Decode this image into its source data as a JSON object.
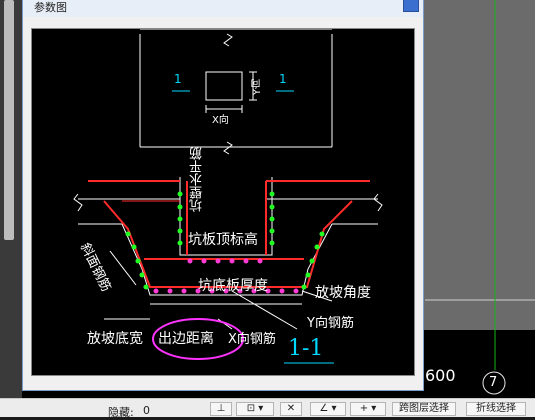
{
  "dialog": {
    "title": "参数图"
  },
  "background": {
    "dimension_text": "600",
    "grid_label": "7"
  },
  "drawing": {
    "top_labels": {
      "section_left": "1",
      "section_right": "1",
      "x_dir": "X向",
      "y_dir": "Y向"
    },
    "labels": {
      "pit_wall_rebar": "坑壁水平筋",
      "pit_top_elev": "坑板顶标高",
      "slope_face_rebar": "斜面钢筋",
      "pit_bottom_thickness": "坑底板厚度",
      "slope_angle": "放坡角度",
      "y_rebar": "Y向钢筋",
      "slope_bottom_width": "放坡底宽",
      "edge_distance": "出边距离",
      "x_rebar": "X向钢筋",
      "section_name": "1-1"
    }
  },
  "statusbar": {
    "hidden_label": "隐藏:",
    "hidden_value": "0",
    "cross_layer_select": "跨图层选择",
    "polyline_select": "折线选择"
  },
  "colors": {
    "rebar": "#ff2a2a",
    "stirrup_dot": "#ff3bd6",
    "corner_dot": "#22ff22",
    "highlight": "#ff33ff",
    "section_label": "#00d9ff"
  }
}
